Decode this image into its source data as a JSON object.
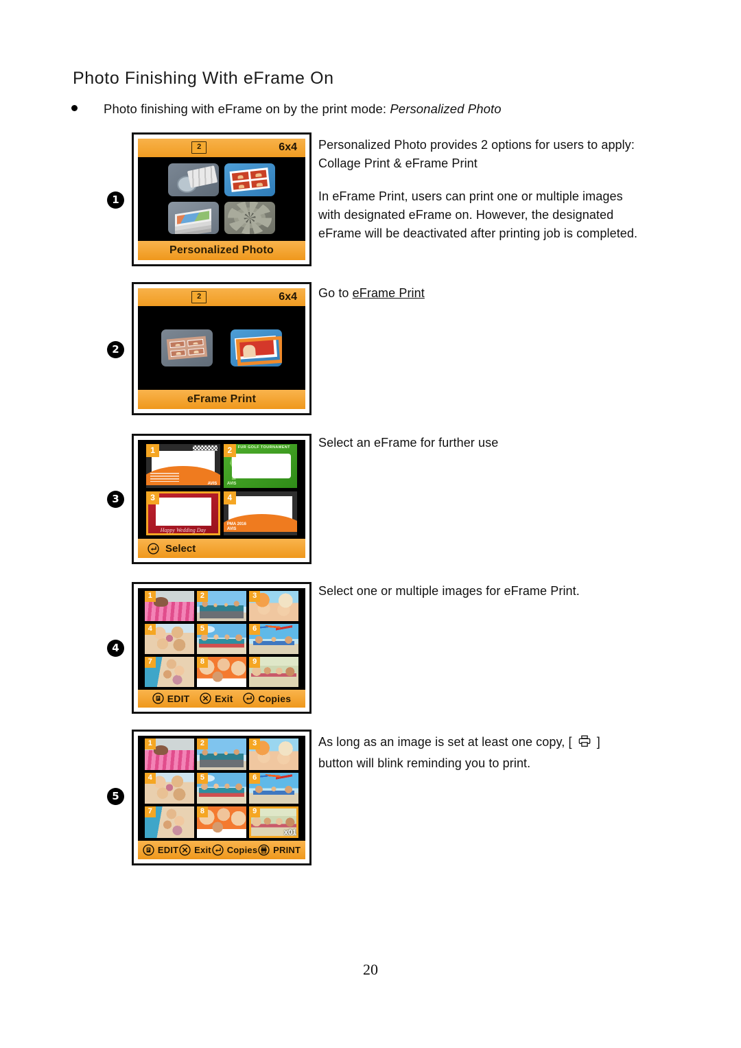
{
  "document": {
    "title": "Photo Finishing With eFrame On",
    "bullet": {
      "text_before": "Photo finishing with eFrame on by the print mode: ",
      "emphasis": "Personalized Photo"
    },
    "page_number": "20"
  },
  "steps": [
    {
      "marker": "1"
    },
    {
      "marker": "2"
    },
    {
      "marker": "3"
    },
    {
      "marker": "4"
    },
    {
      "marker": "5"
    }
  ],
  "notes": {
    "note1_line1": "Personalized Photo provides 2 options for users to apply:",
    "note1_line2": "Collage Print & eFrame Print",
    "note1_line3": "In eFrame Print, users can print one or multiple images",
    "note1_line4": "with designated eFrame on. However, the designated",
    "note1_line5": "eFrame will be deactivated after printing job is completed.",
    "note2_prefix": "Go to ",
    "note2_link": "eFrame Print",
    "note3": "Select an eFrame for further use",
    "note4": "Select one or multiple images for eFrame Print.",
    "note5_part1": "As long as an image is set at least one copy, [",
    "note5_part2": "]",
    "note5_line2": "button will blink reminding you to print."
  },
  "screens": {
    "personalized_photo": {
      "status_badge": "2",
      "print_size": "6x4",
      "footer_label": "Personalized Photo",
      "icons": [
        "clock-collage-icon",
        "photo-collage-icon",
        "photo-stack-icon",
        "gear-icon"
      ]
    },
    "eframe_print": {
      "status_badge": "2",
      "print_size": "6x4",
      "footer_label": "eFrame Print",
      "icons": [
        "four-up-frame-icon",
        "eframe-card-icon"
      ]
    },
    "eframe_chooser": {
      "frames": [
        {
          "number": "1",
          "style": "dark-orange-wave",
          "caption": ""
        },
        {
          "number": "2",
          "style": "green-golf",
          "caption": "MET FUR GOLF TOURNAMENT"
        },
        {
          "number": "3",
          "style": "red-wedding",
          "caption": "Happy Wedding Day"
        },
        {
          "number": "4",
          "style": "dark-orange-arc",
          "caption": ""
        }
      ],
      "selected": "3",
      "action_label": "Select",
      "action_icon": "enter-key-icon"
    },
    "image_select": {
      "thumbs": [
        {
          "number": "1"
        },
        {
          "number": "2"
        },
        {
          "number": "3"
        },
        {
          "number": "4"
        },
        {
          "number": "5"
        },
        {
          "number": "6"
        },
        {
          "number": "7"
        },
        {
          "number": "8"
        },
        {
          "number": "9"
        }
      ],
      "actions": [
        {
          "icon": "edit-icon",
          "label": "EDIT"
        },
        {
          "icon": "close-x-icon",
          "label": "Exit"
        },
        {
          "icon": "enter-key-icon",
          "label": "Copies"
        }
      ]
    },
    "image_select_with_print": {
      "thumbs": [
        {
          "number": "1",
          "copies": ""
        },
        {
          "number": "2",
          "copies": ""
        },
        {
          "number": "3",
          "copies": ""
        },
        {
          "number": "4",
          "copies": ""
        },
        {
          "number": "5",
          "copies": ""
        },
        {
          "number": "6",
          "copies": ""
        },
        {
          "number": "7",
          "copies": ""
        },
        {
          "number": "8",
          "copies": ""
        },
        {
          "number": "9",
          "copies": "x01"
        }
      ],
      "selected": "9",
      "actions": [
        {
          "icon": "edit-icon",
          "label": "EDIT"
        },
        {
          "icon": "close-x-icon",
          "label": "Exit"
        },
        {
          "icon": "enter-key-icon",
          "label": "Copies"
        },
        {
          "icon": "printer-icon",
          "label": "PRINT"
        }
      ]
    }
  },
  "colors": {
    "accent_orange": "#f5a623",
    "bar_orange_light": "#f9b44d",
    "bar_orange_dark": "#ef981c",
    "screen_black": "#000000",
    "text": "#111111"
  }
}
